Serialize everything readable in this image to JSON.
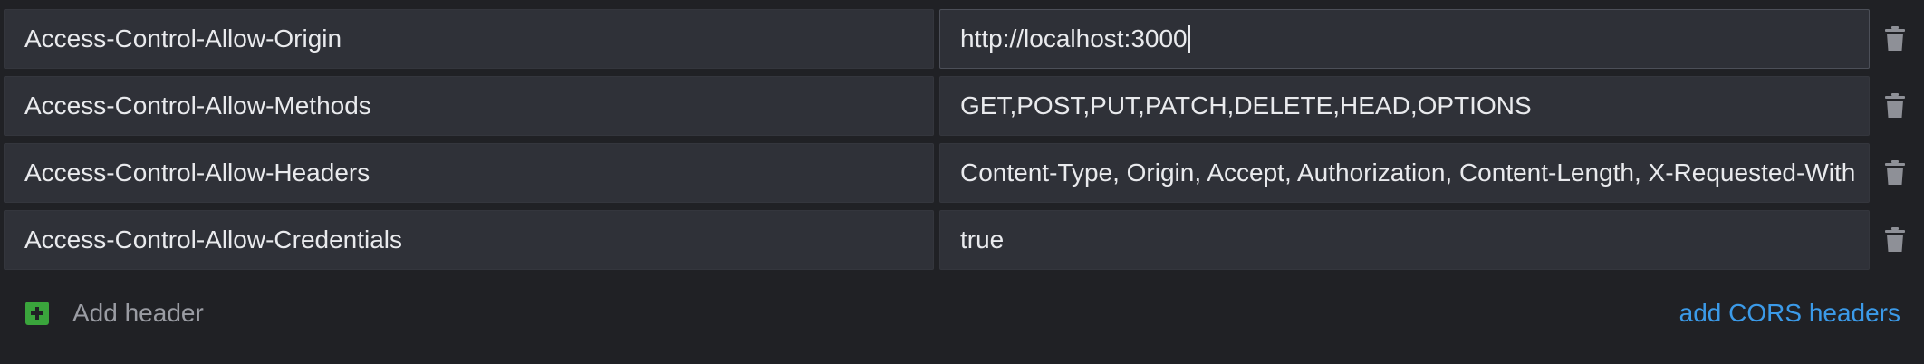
{
  "headers": [
    {
      "key": "Access-Control-Allow-Origin",
      "value": "http://localhost:3000"
    },
    {
      "key": "Access-Control-Allow-Methods",
      "value": "GET,POST,PUT,PATCH,DELETE,HEAD,OPTIONS"
    },
    {
      "key": "Access-Control-Allow-Headers",
      "value": "Content-Type, Origin, Accept, Authorization, Content-Length, X-Requested-With"
    },
    {
      "key": "Access-Control-Allow-Credentials",
      "value": "true"
    }
  ],
  "footer": {
    "add_header_label": "Add header",
    "cors_link_label": "add CORS headers"
  },
  "icons": {
    "delete": "trash-icon",
    "add": "plus-square-icon"
  },
  "colors": {
    "background": "#202125",
    "cell": "#2f3138",
    "text": "#e9eaed",
    "add_icon": "#3aa53c",
    "link": "#3b9ae8",
    "muted": "#9a9ca3",
    "trash": "#8e9097"
  }
}
